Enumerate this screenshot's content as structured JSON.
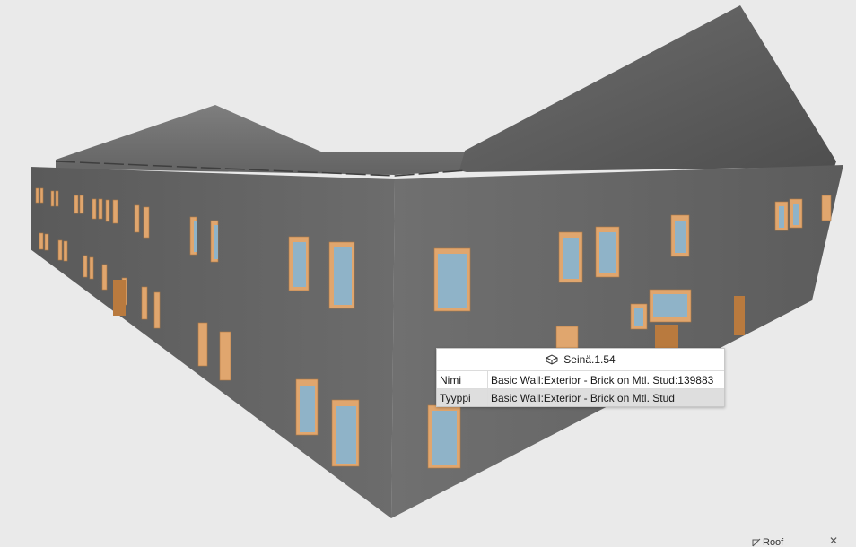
{
  "tooltip": {
    "title": "Seinä.1.54",
    "icon": "wall-icon",
    "rows": [
      {
        "key": "Nimi",
        "value": "Basic Wall:Exterior - Brick on Mtl. Stud:139883"
      },
      {
        "key": "Tyyppi",
        "value": "Basic Wall:Exterior - Brick on Mtl. Stud"
      }
    ]
  },
  "view_cube": {
    "label": "Roof",
    "icon": "view-cube-icon",
    "close_glyph": "✕"
  },
  "colors": {
    "background": "#eaeaea",
    "wall": "#6a6a6a",
    "roof": "#5a5a5a",
    "window_frame": "#e0a66e",
    "glass": "#8fb3c8",
    "door": "#b97a3e"
  }
}
